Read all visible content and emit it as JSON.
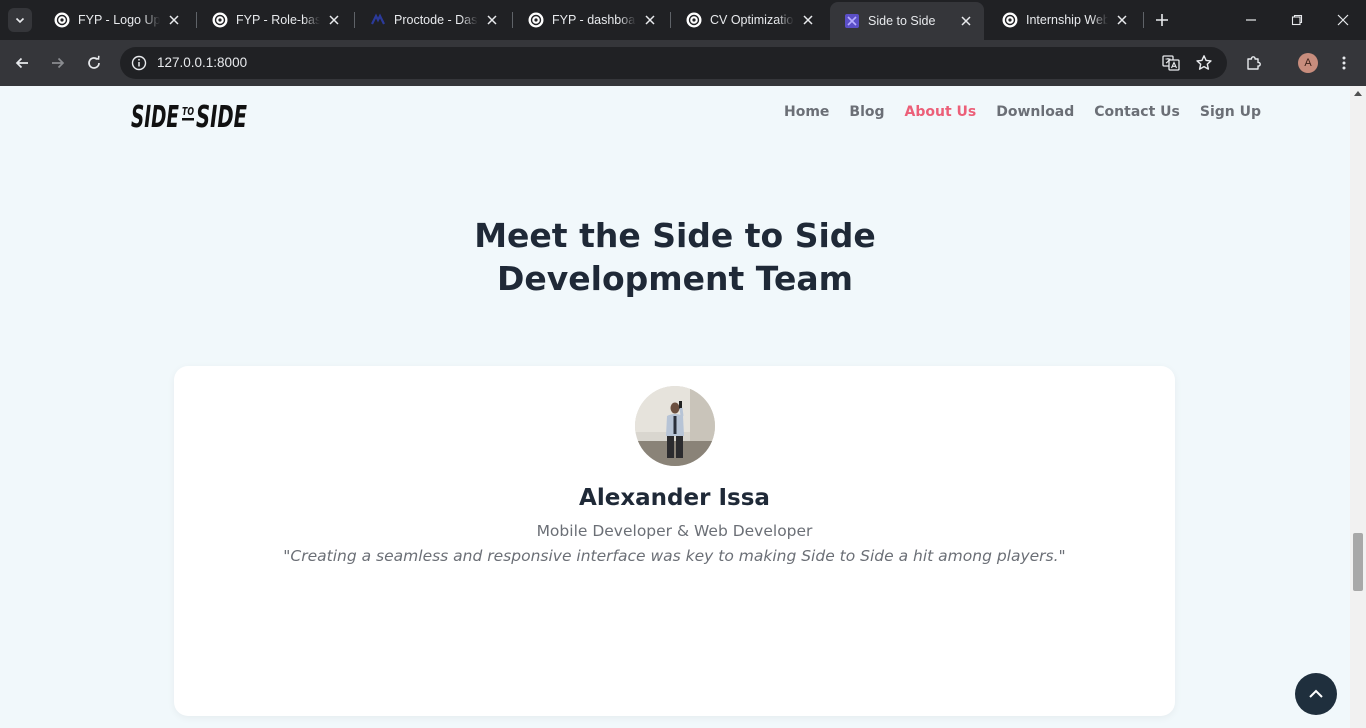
{
  "browser": {
    "tabs": [
      {
        "title": "FYP - Logo Upload",
        "icon": "chatgpt-icon",
        "active": false
      },
      {
        "title": "FYP - Role-based",
        "icon": "chatgpt-icon",
        "active": false
      },
      {
        "title": "Proctode - Dashboard",
        "icon": "proctode-icon",
        "active": false
      },
      {
        "title": "FYP - dashboard",
        "icon": "chatgpt-icon",
        "active": false
      },
      {
        "title": "CV Optimization",
        "icon": "chatgpt-icon",
        "active": false
      },
      {
        "title": "Side to Side",
        "icon": "side-to-side-icon",
        "active": true
      },
      {
        "title": "Internship Web Dev",
        "icon": "chatgpt-icon",
        "active": false
      }
    ],
    "url": "127.0.0.1:8000",
    "profile_initial": "A"
  },
  "site": {
    "logo_text": "SIDE TO SIDE",
    "nav": [
      {
        "label": "Home",
        "active": false
      },
      {
        "label": "Blog",
        "active": false
      },
      {
        "label": "About Us",
        "active": true
      },
      {
        "label": "Download",
        "active": false
      },
      {
        "label": "Contact Us",
        "active": false
      },
      {
        "label": "Sign Up",
        "active": false
      }
    ],
    "accent_color": "#ec5f78"
  },
  "team": {
    "heading_line1": "Meet the Side to Side",
    "heading_line2": "Development Team",
    "member": {
      "name": "Alexander Issa",
      "role": "Mobile Developer & Web Developer",
      "quote": "\"Creating a seamless and responsive interface was key to making Side to Side a hit among players.\""
    }
  },
  "icons": {
    "back_to_top": "chevron-up-icon"
  }
}
